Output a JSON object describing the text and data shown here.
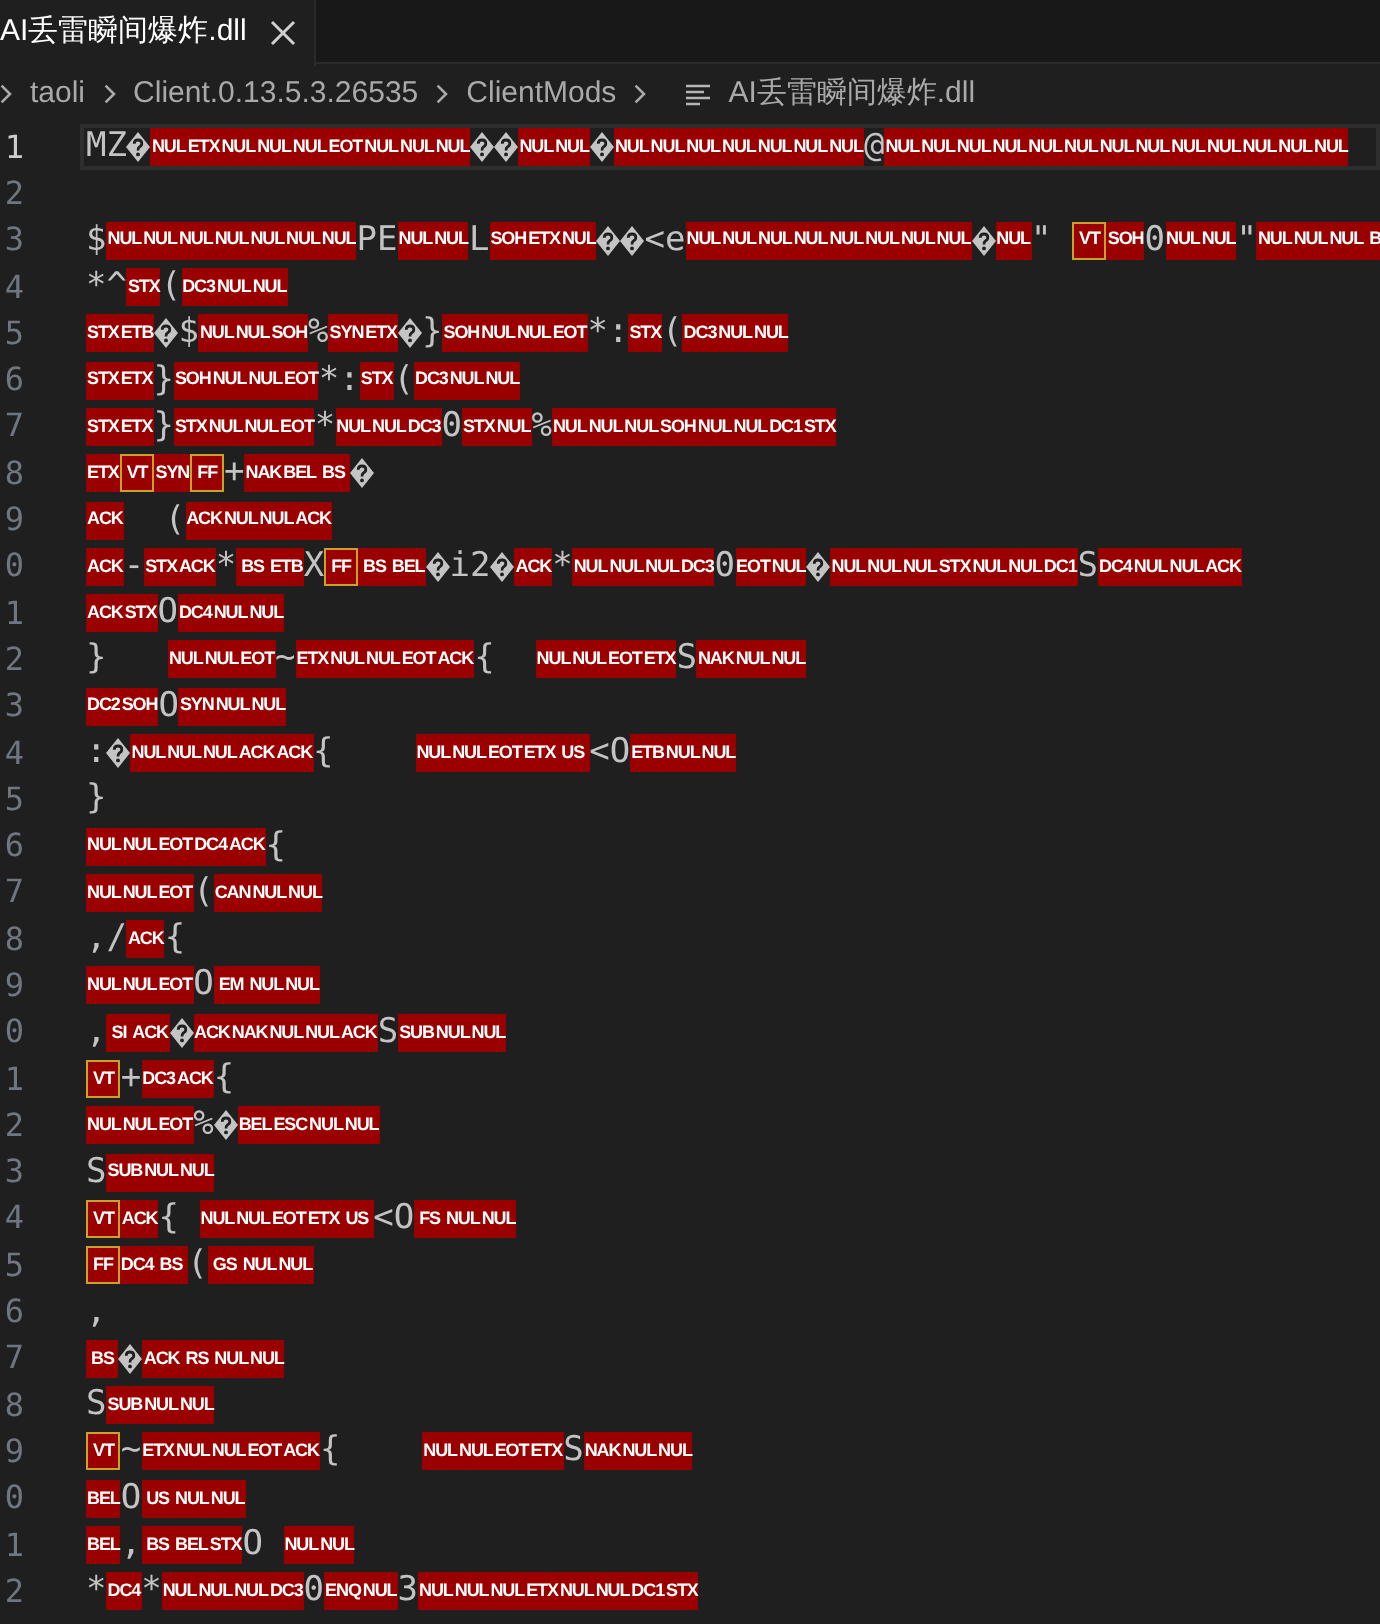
{
  "tabs": [
    {
      "label": "AI丢雷瞬间爆炸.dll",
      "selected": true
    }
  ],
  "breadcrumb": [
    {
      "label": "taoli",
      "kind": "folder"
    },
    {
      "label": "Client.0.13.5.3.26535",
      "kind": "folder"
    },
    {
      "label": "ClientMods",
      "kind": "folder"
    },
    {
      "label": "AI丢雷瞬间爆炸.dll",
      "kind": "file"
    }
  ],
  "editor": {
    "lines": [
      {
        "number": "1",
        "current": true,
        "segments": [
          {
            "kind": "text",
            "text": "MZ"
          },
          {
            "kind": "invalid"
          },
          {
            "kind": "ctrl",
            "codes": [
              "NUL",
              "ETX",
              "NUL",
              "NUL",
              "NUL",
              "EOT",
              "NUL",
              "NUL",
              "NUL"
            ]
          },
          {
            "kind": "invalid"
          },
          {
            "kind": "invalid"
          },
          {
            "kind": "ctrl",
            "codes": [
              "NUL",
              "NUL"
            ]
          },
          {
            "kind": "invalid"
          },
          {
            "kind": "ctrl",
            "codes": [
              "NUL",
              "NUL",
              "NUL",
              "NUL",
              "NUL",
              "NUL",
              "NUL"
            ]
          },
          {
            "kind": "text",
            "text": "@"
          },
          {
            "kind": "ctrl",
            "codes": [
              "NUL",
              "NUL",
              "NUL",
              "NUL",
              "NUL",
              "NUL",
              "NUL",
              "NUL",
              "NUL",
              "NUL",
              "NUL",
              "NUL",
              "NUL"
            ]
          }
        ]
      },
      {
        "number": "2",
        "current": false
      },
      {
        "number": "3",
        "current": false,
        "segments": [
          {
            "kind": "text",
            "text": "$"
          },
          {
            "kind": "ctrl",
            "codes": [
              "NUL",
              "NUL",
              "NUL",
              "NUL",
              "NUL",
              "NUL",
              "NUL"
            ]
          },
          {
            "kind": "text",
            "text": "PE"
          },
          {
            "kind": "ctrl",
            "codes": [
              "NUL",
              "NUL"
            ]
          },
          {
            "kind": "text",
            "text": "L"
          },
          {
            "kind": "ctrl",
            "codes": [
              "SOH",
              "ETX",
              "NUL"
            ]
          },
          {
            "kind": "invalid"
          },
          {
            "kind": "invalid"
          },
          {
            "kind": "text",
            "text": "<e"
          },
          {
            "kind": "ctrl",
            "codes": [
              "NUL",
              "NUL",
              "NUL",
              "NUL",
              "NUL",
              "NUL",
              "NUL",
              "NUL"
            ]
          },
          {
            "kind": "invalid"
          },
          {
            "kind": "ctrl",
            "codes": [
              "NUL"
            ]
          },
          {
            "kind": "text",
            "text": "\" "
          },
          {
            "kind": "flagged",
            "codes": [
              "VT"
            ]
          },
          {
            "kind": "ctrl",
            "codes": [
              "SOH"
            ]
          },
          {
            "kind": "text",
            "text": "0"
          },
          {
            "kind": "ctrl",
            "codes": [
              "NUL",
              "NUL"
            ]
          },
          {
            "kind": "text",
            "text": "\""
          },
          {
            "kind": "ctrl",
            "codes": [
              "NUL",
              "NUL",
              "NUL",
              "B"
            ]
          }
        ]
      },
      {
        "number": "4",
        "current": false,
        "segments": [
          {
            "kind": "text",
            "text": "*^"
          },
          {
            "kind": "ctrl",
            "codes": [
              "STX"
            ]
          },
          {
            "kind": "text",
            "text": "("
          },
          {
            "kind": "ctrl",
            "codes": [
              "DC3",
              "NUL",
              "NUL"
            ]
          }
        ]
      },
      {
        "number": "5",
        "current": false,
        "segments": [
          {
            "kind": "ctrl",
            "codes": [
              "STX",
              "ETB"
            ]
          },
          {
            "kind": "invalid"
          },
          {
            "kind": "text",
            "text": "$"
          },
          {
            "kind": "ctrl",
            "codes": [
              "NUL",
              "NUL",
              "SOH"
            ]
          },
          {
            "kind": "text",
            "text": "%"
          },
          {
            "kind": "ctrl",
            "codes": [
              "SYN",
              "ETX"
            ]
          },
          {
            "kind": "invalid"
          },
          {
            "kind": "text",
            "text": "}"
          },
          {
            "kind": "ctrl",
            "codes": [
              "SOH",
              "NUL",
              "NUL",
              "EOT"
            ]
          },
          {
            "kind": "text",
            "text": "*:"
          },
          {
            "kind": "ctrl",
            "codes": [
              "STX"
            ]
          },
          {
            "kind": "text",
            "text": "("
          },
          {
            "kind": "ctrl",
            "codes": [
              "DC3",
              "NUL",
              "NUL"
            ]
          }
        ]
      },
      {
        "number": "6",
        "current": false,
        "segments": [
          {
            "kind": "ctrl",
            "codes": [
              "STX",
              "ETX"
            ]
          },
          {
            "kind": "text",
            "text": "}"
          },
          {
            "kind": "ctrl",
            "codes": [
              "SOH",
              "NUL",
              "NUL",
              "EOT"
            ]
          },
          {
            "kind": "text",
            "text": "*:"
          },
          {
            "kind": "ctrl",
            "codes": [
              "STX"
            ]
          },
          {
            "kind": "text",
            "text": "("
          },
          {
            "kind": "ctrl",
            "codes": [
              "DC3",
              "NUL",
              "NUL"
            ]
          }
        ]
      },
      {
        "number": "7",
        "current": false,
        "segments": [
          {
            "kind": "ctrl",
            "codes": [
              "STX",
              "ETX"
            ]
          },
          {
            "kind": "text",
            "text": "}"
          },
          {
            "kind": "ctrl",
            "codes": [
              "STX",
              "NUL",
              "NUL",
              "EOT"
            ]
          },
          {
            "kind": "text",
            "text": "*"
          },
          {
            "kind": "ctrl",
            "codes": [
              "NUL",
              "NUL",
              "DC3"
            ]
          },
          {
            "kind": "text",
            "text": "0"
          },
          {
            "kind": "ctrl",
            "codes": [
              "STX",
              "NUL"
            ]
          },
          {
            "kind": "text",
            "text": "%"
          },
          {
            "kind": "ctrl",
            "codes": [
              "NUL",
              "NUL",
              "NUL",
              "SOH",
              "NUL",
              "NUL",
              "DC1",
              "STX"
            ]
          }
        ]
      },
      {
        "number": "8",
        "current": false,
        "segments": [
          {
            "kind": "ctrl",
            "codes": [
              "ETX"
            ]
          },
          {
            "kind": "flagged",
            "codes": [
              "VT"
            ]
          },
          {
            "kind": "ctrl",
            "codes": [
              "SYN"
            ]
          },
          {
            "kind": "flagged",
            "codes": [
              "FF"
            ]
          },
          {
            "kind": "text",
            "text": "+"
          },
          {
            "kind": "ctrl",
            "codes": [
              "NAK",
              "BEL",
              "BS"
            ]
          },
          {
            "kind": "invalid"
          }
        ]
      },
      {
        "number": "9",
        "current": false,
        "segments": [
          {
            "kind": "ctrl",
            "codes": [
              "ACK"
            ]
          },
          {
            "kind": "text",
            "text": "  ("
          },
          {
            "kind": "ctrl",
            "codes": [
              "ACK",
              "NUL",
              "NUL",
              "ACK"
            ]
          }
        ]
      },
      {
        "number": "0",
        "current": false,
        "segments": [
          {
            "kind": "ctrl",
            "codes": [
              "ACK"
            ]
          },
          {
            "kind": "text",
            "text": "-"
          },
          {
            "kind": "ctrl",
            "codes": [
              "STX",
              "ACK"
            ]
          },
          {
            "kind": "text",
            "text": "*"
          },
          {
            "kind": "ctrl",
            "codes": [
              "BS",
              "ETB"
            ]
          },
          {
            "kind": "text",
            "text": "X"
          },
          {
            "kind": "flagged",
            "codes": [
              "FF"
            ]
          },
          {
            "kind": "ctrl",
            "codes": [
              "BS",
              "BEL"
            ]
          },
          {
            "kind": "invalid"
          },
          {
            "kind": "text",
            "text": "i2"
          },
          {
            "kind": "invalid"
          },
          {
            "kind": "ctrl",
            "codes": [
              "ACK"
            ]
          },
          {
            "kind": "text",
            "text": "*"
          },
          {
            "kind": "ctrl",
            "codes": [
              "NUL",
              "NUL",
              "NUL",
              "DC3"
            ]
          },
          {
            "kind": "text",
            "text": "0"
          },
          {
            "kind": "ctrl",
            "codes": [
              "EOT",
              "NUL"
            ]
          },
          {
            "kind": "invalid"
          },
          {
            "kind": "ctrl",
            "codes": [
              "NUL",
              "NUL",
              "NUL",
              "STX",
              "NUL",
              "NUL",
              "DC1"
            ]
          },
          {
            "kind": "text",
            "text": "S"
          },
          {
            "kind": "ctrl",
            "codes": [
              "DC4",
              "NUL",
              "NUL",
              "ACK"
            ]
          }
        ]
      },
      {
        "number": "1",
        "current": false,
        "segments": [
          {
            "kind": "ctrl",
            "codes": [
              "ACK",
              "STX"
            ]
          },
          {
            "kind": "text",
            "text": "O"
          },
          {
            "kind": "ctrl",
            "codes": [
              "DC4",
              "NUL",
              "NUL"
            ]
          }
        ]
      },
      {
        "number": "2",
        "current": false,
        "segments": [
          {
            "kind": "text",
            "text": "}   "
          },
          {
            "kind": "ctrl",
            "codes": [
              "NUL",
              "NUL",
              "EOT"
            ]
          },
          {
            "kind": "text",
            "text": "~"
          },
          {
            "kind": "ctrl",
            "codes": [
              "ETX",
              "NUL",
              "NUL",
              "EOT",
              "ACK"
            ]
          },
          {
            "kind": "text",
            "text": "{  "
          },
          {
            "kind": "ctrl",
            "codes": [
              "NUL",
              "NUL",
              "EOT",
              "ETX"
            ]
          },
          {
            "kind": "text",
            "text": "S"
          },
          {
            "kind": "ctrl",
            "codes": [
              "NAK",
              "NUL",
              "NUL"
            ]
          }
        ]
      },
      {
        "number": "3",
        "current": false,
        "segments": [
          {
            "kind": "ctrl",
            "codes": [
              "DC2",
              "SOH"
            ]
          },
          {
            "kind": "text",
            "text": "O"
          },
          {
            "kind": "ctrl",
            "codes": [
              "SYN",
              "NUL",
              "NUL"
            ]
          }
        ]
      },
      {
        "number": "4",
        "current": false,
        "segments": [
          {
            "kind": "text",
            "text": ":"
          },
          {
            "kind": "invalid"
          },
          {
            "kind": "ctrl",
            "codes": [
              "NUL",
              "NUL",
              "NUL",
              "ACK",
              "ACK"
            ]
          },
          {
            "kind": "text",
            "text": "{    "
          },
          {
            "kind": "ctrl",
            "codes": [
              "NUL",
              "NUL",
              "EOT",
              "ETX",
              "US"
            ]
          },
          {
            "kind": "text",
            "text": "<O"
          },
          {
            "kind": "ctrl",
            "codes": [
              "ETB",
              "NUL",
              "NUL"
            ]
          }
        ]
      },
      {
        "number": "5",
        "current": false,
        "segments": [
          {
            "kind": "text",
            "text": "}"
          }
        ]
      },
      {
        "number": "6",
        "current": false,
        "segments": [
          {
            "kind": "ctrl",
            "codes": [
              "NUL",
              "NUL",
              "EOT",
              "DC4",
              "ACK"
            ]
          },
          {
            "kind": "text",
            "text": "{"
          }
        ]
      },
      {
        "number": "7",
        "current": false,
        "segments": [
          {
            "kind": "ctrl",
            "codes": [
              "NUL",
              "NUL",
              "EOT"
            ]
          },
          {
            "kind": "text",
            "text": "("
          },
          {
            "kind": "ctrl",
            "codes": [
              "CAN",
              "NUL",
              "NUL"
            ]
          }
        ]
      },
      {
        "number": "8",
        "current": false,
        "segments": [
          {
            "kind": "text",
            "text": ",/"
          },
          {
            "kind": "ctrl",
            "codes": [
              "ACK"
            ]
          },
          {
            "kind": "text",
            "text": "{"
          }
        ]
      },
      {
        "number": "9",
        "current": false,
        "segments": [
          {
            "kind": "ctrl",
            "codes": [
              "NUL",
              "NUL",
              "EOT"
            ]
          },
          {
            "kind": "text",
            "text": "O"
          },
          {
            "kind": "ctrl",
            "codes": [
              "EM",
              "NUL",
              "NUL"
            ]
          }
        ]
      },
      {
        "number": "0",
        "current": false,
        "segments": [
          {
            "kind": "text",
            "text": ","
          },
          {
            "kind": "ctrl",
            "codes": [
              "SI",
              "ACK"
            ]
          },
          {
            "kind": "invalid"
          },
          {
            "kind": "ctrl",
            "codes": [
              "ACK",
              "NAK",
              "NUL",
              "NUL",
              "ACK"
            ]
          },
          {
            "kind": "text",
            "text": "S"
          },
          {
            "kind": "ctrl",
            "codes": [
              "SUB",
              "NUL",
              "NUL"
            ]
          }
        ]
      },
      {
        "number": "1",
        "current": false,
        "segments": [
          {
            "kind": "flagged",
            "codes": [
              "VT"
            ]
          },
          {
            "kind": "text",
            "text": "+"
          },
          {
            "kind": "ctrl",
            "codes": [
              "DC3",
              "ACK"
            ]
          },
          {
            "kind": "text",
            "text": "{"
          }
        ]
      },
      {
        "number": "2",
        "current": false,
        "segments": [
          {
            "kind": "ctrl",
            "codes": [
              "NUL",
              "NUL",
              "EOT"
            ]
          },
          {
            "kind": "text",
            "text": "%"
          },
          {
            "kind": "invalid"
          },
          {
            "kind": "ctrl",
            "codes": [
              "BEL",
              "ESC",
              "NUL",
              "NUL"
            ]
          }
        ]
      },
      {
        "number": "3",
        "current": false,
        "segments": [
          {
            "kind": "text",
            "text": "S"
          },
          {
            "kind": "ctrl",
            "codes": [
              "SUB",
              "NUL",
              "NUL"
            ]
          }
        ]
      },
      {
        "number": "4",
        "current": false,
        "segments": [
          {
            "kind": "flagged",
            "codes": [
              "VT"
            ]
          },
          {
            "kind": "ctrl",
            "codes": [
              "ACK"
            ]
          },
          {
            "kind": "text",
            "text": "{ "
          },
          {
            "kind": "ctrl",
            "codes": [
              "NUL",
              "NUL",
              "EOT",
              "ETX",
              "US"
            ]
          },
          {
            "kind": "text",
            "text": "<O"
          },
          {
            "kind": "ctrl",
            "codes": [
              "FS",
              "NUL",
              "NUL"
            ]
          }
        ]
      },
      {
        "number": "5",
        "current": false,
        "segments": [
          {
            "kind": "flagged",
            "codes": [
              "FF"
            ]
          },
          {
            "kind": "ctrl",
            "codes": [
              "DC4",
              "BS"
            ]
          },
          {
            "kind": "text",
            "text": "("
          },
          {
            "kind": "ctrl",
            "codes": [
              "GS",
              "NUL",
              "NUL"
            ]
          }
        ]
      },
      {
        "number": "6",
        "current": false,
        "segments": [
          {
            "kind": "text",
            "text": ","
          }
        ]
      },
      {
        "number": "7",
        "current": false,
        "segments": [
          {
            "kind": "ctrl",
            "codes": [
              "BS"
            ]
          },
          {
            "kind": "invalid"
          },
          {
            "kind": "ctrl",
            "codes": [
              "ACK",
              "RS",
              "NUL",
              "NUL"
            ]
          }
        ]
      },
      {
        "number": "8",
        "current": false,
        "segments": [
          {
            "kind": "text",
            "text": "S"
          },
          {
            "kind": "ctrl",
            "codes": [
              "SUB",
              "NUL",
              "NUL"
            ]
          }
        ]
      },
      {
        "number": "9",
        "current": false,
        "segments": [
          {
            "kind": "flagged",
            "codes": [
              "VT"
            ]
          },
          {
            "kind": "text",
            "text": "~"
          },
          {
            "kind": "ctrl",
            "codes": [
              "ETX",
              "NUL",
              "NUL",
              "EOT",
              "ACK"
            ]
          },
          {
            "kind": "text",
            "text": "{    "
          },
          {
            "kind": "ctrl",
            "codes": [
              "NUL",
              "NUL",
              "EOT",
              "ETX"
            ]
          },
          {
            "kind": "text",
            "text": "S"
          },
          {
            "kind": "ctrl",
            "codes": [
              "NAK",
              "NUL",
              "NUL"
            ]
          }
        ]
      },
      {
        "number": "0",
        "current": false,
        "segments": [
          {
            "kind": "ctrl",
            "codes": [
              "BEL"
            ]
          },
          {
            "kind": "text",
            "text": "O"
          },
          {
            "kind": "ctrl",
            "codes": [
              "US",
              "NUL",
              "NUL"
            ]
          }
        ]
      },
      {
        "number": "1",
        "current": false,
        "segments": [
          {
            "kind": "ctrl",
            "codes": [
              "BEL"
            ]
          },
          {
            "kind": "text",
            "text": ","
          },
          {
            "kind": "ctrl",
            "codes": [
              "BS",
              "BEL",
              "STX"
            ]
          },
          {
            "kind": "text",
            "text": "O "
          },
          {
            "kind": "ctrl",
            "codes": [
              "NUL",
              "NUL"
            ]
          }
        ]
      },
      {
        "number": "2",
        "current": false,
        "segments": [
          {
            "kind": "text",
            "text": "*"
          },
          {
            "kind": "ctrl",
            "codes": [
              "DC4"
            ]
          },
          {
            "kind": "text",
            "text": "*"
          },
          {
            "kind": "ctrl",
            "codes": [
              "NUL",
              "NUL",
              "NUL",
              "DC3"
            ]
          },
          {
            "kind": "text",
            "text": "0"
          },
          {
            "kind": "ctrl",
            "codes": [
              "ENQ",
              "NUL"
            ]
          },
          {
            "kind": "text",
            "text": "3"
          },
          {
            "kind": "ctrl",
            "codes": [
              "NUL",
              "NUL",
              "NUL",
              "ETX",
              "NUL",
              "NUL",
              "DC1",
              "STX"
            ]
          }
        ]
      }
    ]
  }
}
